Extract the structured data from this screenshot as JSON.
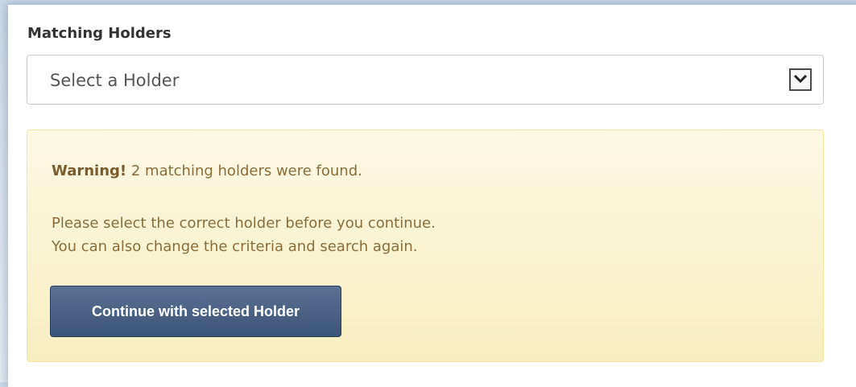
{
  "field": {
    "label": "Matching Holders",
    "select_value": "Select a Holder",
    "dropdown_icon": "chevron-down-icon"
  },
  "alert": {
    "strong": "Warning!",
    "message": " 2 matching holders were found.",
    "instruction_line1": "Please select the correct holder before you continue.",
    "instruction_line2": "You can also change the criteria and search again.",
    "button_label": "Continue with selected Holder"
  },
  "colors": {
    "alert_background": "#fcf8e3",
    "alert_text": "#8a6d3b",
    "button_background": "#3c5478"
  }
}
